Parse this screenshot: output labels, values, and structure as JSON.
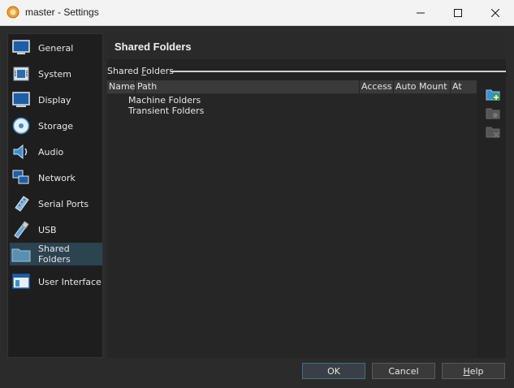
{
  "window": {
    "title": "master - Settings",
    "icon": "virtualbox-icon"
  },
  "sidebar": {
    "items": [
      {
        "label": "General",
        "icon": "monitor-general-icon"
      },
      {
        "label": "System",
        "icon": "chip-icon"
      },
      {
        "label": "Display",
        "icon": "display-icon"
      },
      {
        "label": "Storage",
        "icon": "disk-icon"
      },
      {
        "label": "Audio",
        "icon": "speaker-icon"
      },
      {
        "label": "Network",
        "icon": "network-icon"
      },
      {
        "label": "Serial Ports",
        "icon": "serial-port-icon"
      },
      {
        "label": "USB",
        "icon": "usb-icon"
      },
      {
        "label": "Shared Folders",
        "icon": "folder-icon",
        "selected": true
      },
      {
        "label": "User Interface",
        "icon": "window-icon"
      }
    ]
  },
  "main": {
    "page_title": "Shared Folders",
    "group_label": "Shared Folders",
    "group_label_accel": "F",
    "table": {
      "columns": [
        "Name",
        "Path",
        "Access",
        "Auto Mount",
        "At"
      ],
      "rows": [
        "Machine Folders",
        "Transient Folders"
      ]
    },
    "tools": [
      "add-folder-icon",
      "edit-folder-icon",
      "remove-folder-icon"
    ]
  },
  "buttons": {
    "ok": "OK",
    "cancel": "Cancel",
    "help_prefix": "H",
    "help_rest": "elp"
  },
  "colors": {
    "selection": "#2c4350",
    "accent": "#3f7080"
  }
}
